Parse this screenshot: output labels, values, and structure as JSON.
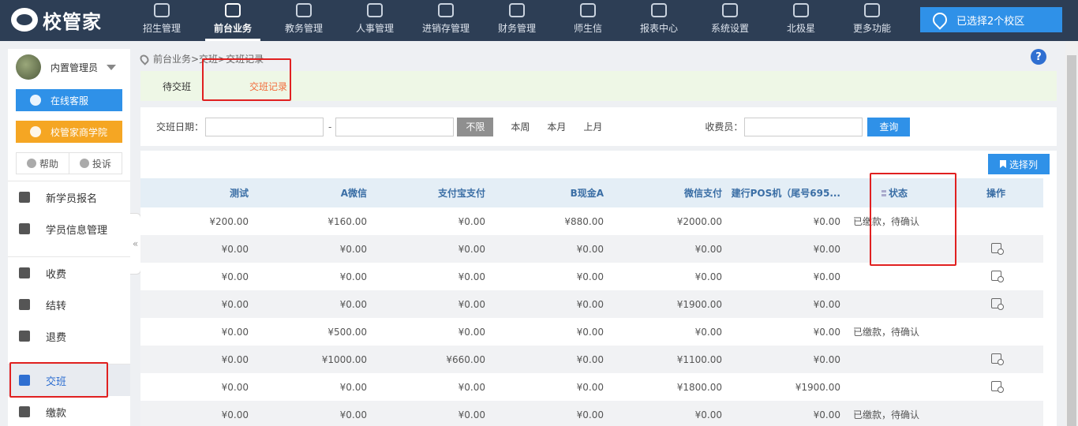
{
  "brand": {
    "name": "校管家"
  },
  "nav": {
    "items": [
      {
        "label": "招生管理",
        "icon": "enroll-icon"
      },
      {
        "label": "前台业务",
        "icon": "desk-icon",
        "active": true
      },
      {
        "label": "教务管理",
        "icon": "academic-icon"
      },
      {
        "label": "人事管理",
        "icon": "people-icon"
      },
      {
        "label": "进销存管理",
        "icon": "inventory-icon"
      },
      {
        "label": "财务管理",
        "icon": "finance-icon"
      },
      {
        "label": "师生信",
        "icon": "message-icon"
      },
      {
        "label": "报表中心",
        "icon": "report-icon"
      },
      {
        "label": "系统设置",
        "icon": "gear-icon"
      },
      {
        "label": "北极星",
        "icon": "star-icon"
      },
      {
        "label": "更多功能",
        "icon": "more-icon"
      }
    ],
    "campus_button": "已选择2个校区"
  },
  "sidebar": {
    "user_name": "内置管理员",
    "online_service": "在线客服",
    "academy": "校管家商学院",
    "help": "帮助",
    "complain": "投诉",
    "menu": [
      {
        "label": "新学员报名",
        "icon": "graduation-cap-icon"
      },
      {
        "label": "学员信息管理",
        "icon": "id-card-icon"
      },
      {
        "label": "收费",
        "icon": "wallet-icon"
      },
      {
        "label": "结转",
        "icon": "transfer-icon"
      },
      {
        "label": "退费",
        "icon": "refund-icon"
      },
      {
        "label": "交班",
        "icon": "handover-icon",
        "active": true
      },
      {
        "label": "缴款",
        "icon": "payment-icon"
      }
    ],
    "collapse_symbol": "«"
  },
  "breadcrumb": "前台业务>交班>交班记录",
  "help_symbol": "?",
  "tabs": [
    {
      "label": "待交班"
    },
    {
      "label": "交班记录",
      "active": true
    }
  ],
  "filter": {
    "date_label": "交班日期：",
    "dash": "-",
    "range_all": "不限",
    "this_week": "本周",
    "this_month": "本月",
    "last_month": "上月",
    "cashier_label": "收费员：",
    "query": "查询"
  },
  "table": {
    "select_columns": "选择列",
    "headers": [
      "测试",
      "A微信",
      "支付宝支付",
      "B现金A",
      "微信支付",
      "建行POS机（尾号695...",
      "状态",
      "操作"
    ],
    "rows": [
      {
        "cells": [
          "¥200.00",
          "¥160.00",
          "¥0.00",
          "¥880.00",
          "¥2000.00",
          "¥0.00"
        ],
        "state": "已缴款，待确认",
        "op": false
      },
      {
        "cells": [
          "¥0.00",
          "¥0.00",
          "¥0.00",
          "¥0.00",
          "¥0.00",
          "¥0.00"
        ],
        "state": "",
        "op": true
      },
      {
        "cells": [
          "¥0.00",
          "¥0.00",
          "¥0.00",
          "¥0.00",
          "¥0.00",
          "¥0.00"
        ],
        "state": "",
        "op": true
      },
      {
        "cells": [
          "¥0.00",
          "¥0.00",
          "¥0.00",
          "¥0.00",
          "¥1900.00",
          "¥0.00"
        ],
        "state": "",
        "op": true
      },
      {
        "cells": [
          "¥0.00",
          "¥500.00",
          "¥0.00",
          "¥0.00",
          "¥0.00",
          "¥0.00"
        ],
        "state": "已缴款，待确认",
        "op": false
      },
      {
        "cells": [
          "¥0.00",
          "¥1000.00",
          "¥660.00",
          "¥0.00",
          "¥1100.00",
          "¥0.00"
        ],
        "state": "",
        "op": true
      },
      {
        "cells": [
          "¥0.00",
          "¥0.00",
          "¥0.00",
          "¥0.00",
          "¥1800.00",
          "¥1900.00"
        ],
        "state": "",
        "op": true
      },
      {
        "cells": [
          "¥0.00",
          "¥0.00",
          "¥0.00",
          "¥0.00",
          "¥0.00",
          "¥0.00"
        ],
        "state": "已缴款，待确认",
        "op": false
      }
    ]
  },
  "colors": {
    "nav_bg": "#2d3e55",
    "accent_blue": "#2f91e8",
    "accent_orange": "#f5a623",
    "active_tab": "#f26b3a",
    "highlight": "#e02020"
  }
}
